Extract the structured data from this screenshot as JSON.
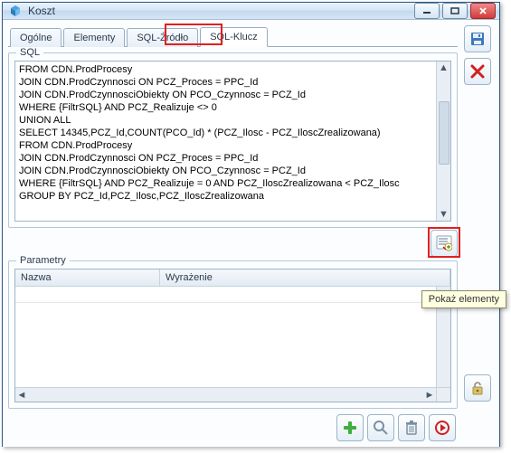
{
  "window": {
    "title": "Koszt"
  },
  "tabs": {
    "general": "Ogólne",
    "elements": "Elementy",
    "sqlsource": "SQL-Źródło",
    "sqlkey": "SQL-Klucz"
  },
  "groups": {
    "sql_label": "SQL",
    "params_label": "Parametry"
  },
  "sql_text": "FROM CDN.ProdProcesy\nJOIN CDN.ProdCzynnosci ON PCZ_Proces = PPC_Id\nJOIN CDN.ProdCzynnosciObiekty ON PCO_Czynnosc = PCZ_Id\nWHERE {FiltrSQL} AND PCZ_Realizuje <> 0\nUNION ALL\nSELECT 14345,PCZ_Id,COUNT(PCO_Id) * (PCZ_Ilosc - PCZ_IloscZrealizowana)\nFROM CDN.ProdProcesy\nJOIN CDN.ProdCzynnosci ON PCZ_Proces = PPC_Id\nJOIN CDN.ProdCzynnosciObiekty ON PCO_Czynnosc = PCZ_Id\nWHERE {FiltrSQL} AND PCZ_Realizuje = 0 AND PCZ_IloscZrealizowana < PCZ_Ilosc\nGROUP BY PCZ_Id,PCZ_Ilosc,PCZ_IloscZrealizowana",
  "params": {
    "col_name": "Nazwa",
    "col_expr": "Wyrażenie"
  },
  "tooltip": "Pokaż elementy",
  "icons": {
    "app": "app-icon",
    "save": "save-icon",
    "close_red": "close-x-icon",
    "show_elements": "show-elements-icon",
    "lock": "lock-icon",
    "add": "add-icon",
    "search": "search-icon",
    "delete": "delete-icon",
    "run": "run-icon"
  },
  "colors": {
    "highlight": "#e02020"
  }
}
